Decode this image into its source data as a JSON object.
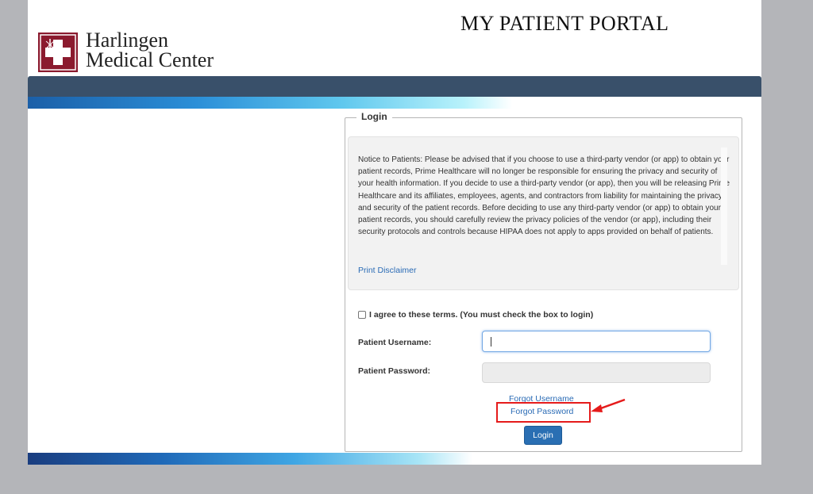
{
  "header": {
    "logo_icon": "hospital-cross-logo",
    "logo_line1": "Harlingen",
    "logo_line2": "Medical Center",
    "portal_title": "MY PATIENT PORTAL"
  },
  "colors": {
    "navbar": "#39506a",
    "link": "#2a6bb5",
    "button": "#2a6fb3",
    "logo_maroon": "#8b1a2e",
    "highlight": "#e51b1b"
  },
  "login": {
    "legend": "Login",
    "notice": "Notice to Patients: Please be advised that if you choose to use a third-party vendor (or app) to obtain your patient records, Prime Healthcare will no longer be responsible for ensuring the privacy and security of your health information. If you decide to use a third-party vendor (or app), then you will be releasing Prime Healthcare and its affiliates, employees, agents, and contractors from liability for maintaining the privacy and security of the patient records. Before deciding to use any third-party vendor (or app) to obtain your patient records, you should carefully review the privacy policies of the vendor (or app), including their security protocols and controls because HIPAA does not apply to apps provided on behalf of patients.",
    "print_disclaimer": "Print Disclaimer",
    "terms_label": "I agree to these terms. (You must check the box to login)",
    "terms_checked": false,
    "username_label": "Patient Username:",
    "username_value": "",
    "password_label": "Patient Password:",
    "password_value": "",
    "forgot_username": "Forgot Username",
    "forgot_password": "Forgot Password",
    "login_button": "Login"
  },
  "annotation": {
    "type": "red-box-and-arrow",
    "target": "forgot-password-link"
  }
}
